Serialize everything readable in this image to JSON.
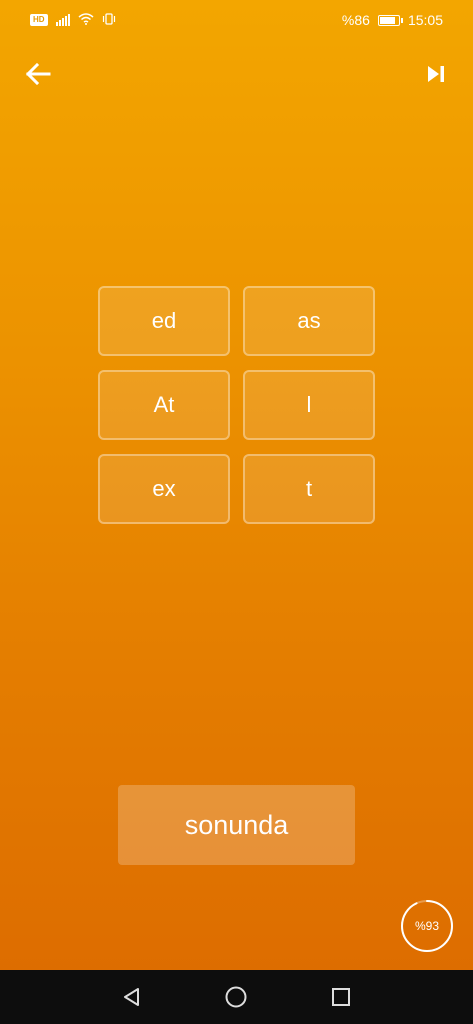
{
  "status_bar": {
    "battery_percent": "%86",
    "battery_level": 0.86,
    "time": "15:05",
    "icons": [
      "hd-icon",
      "signal-icon",
      "wifi-icon",
      "vibrate-icon",
      "battery-icon"
    ]
  },
  "header": {
    "back_icon": "arrow-left-icon",
    "skip_icon": "skip-next-icon"
  },
  "tiles": [
    {
      "label": "ed"
    },
    {
      "label": "as"
    },
    {
      "label": "At"
    },
    {
      "label": "l"
    },
    {
      "label": "ex"
    },
    {
      "label": "t"
    }
  ],
  "answer": {
    "text": "sonunda"
  },
  "progress": {
    "label": "%93",
    "value": 0.93
  },
  "nav": {
    "icons": [
      "back-triangle-icon",
      "home-circle-icon",
      "recents-square-icon"
    ]
  }
}
